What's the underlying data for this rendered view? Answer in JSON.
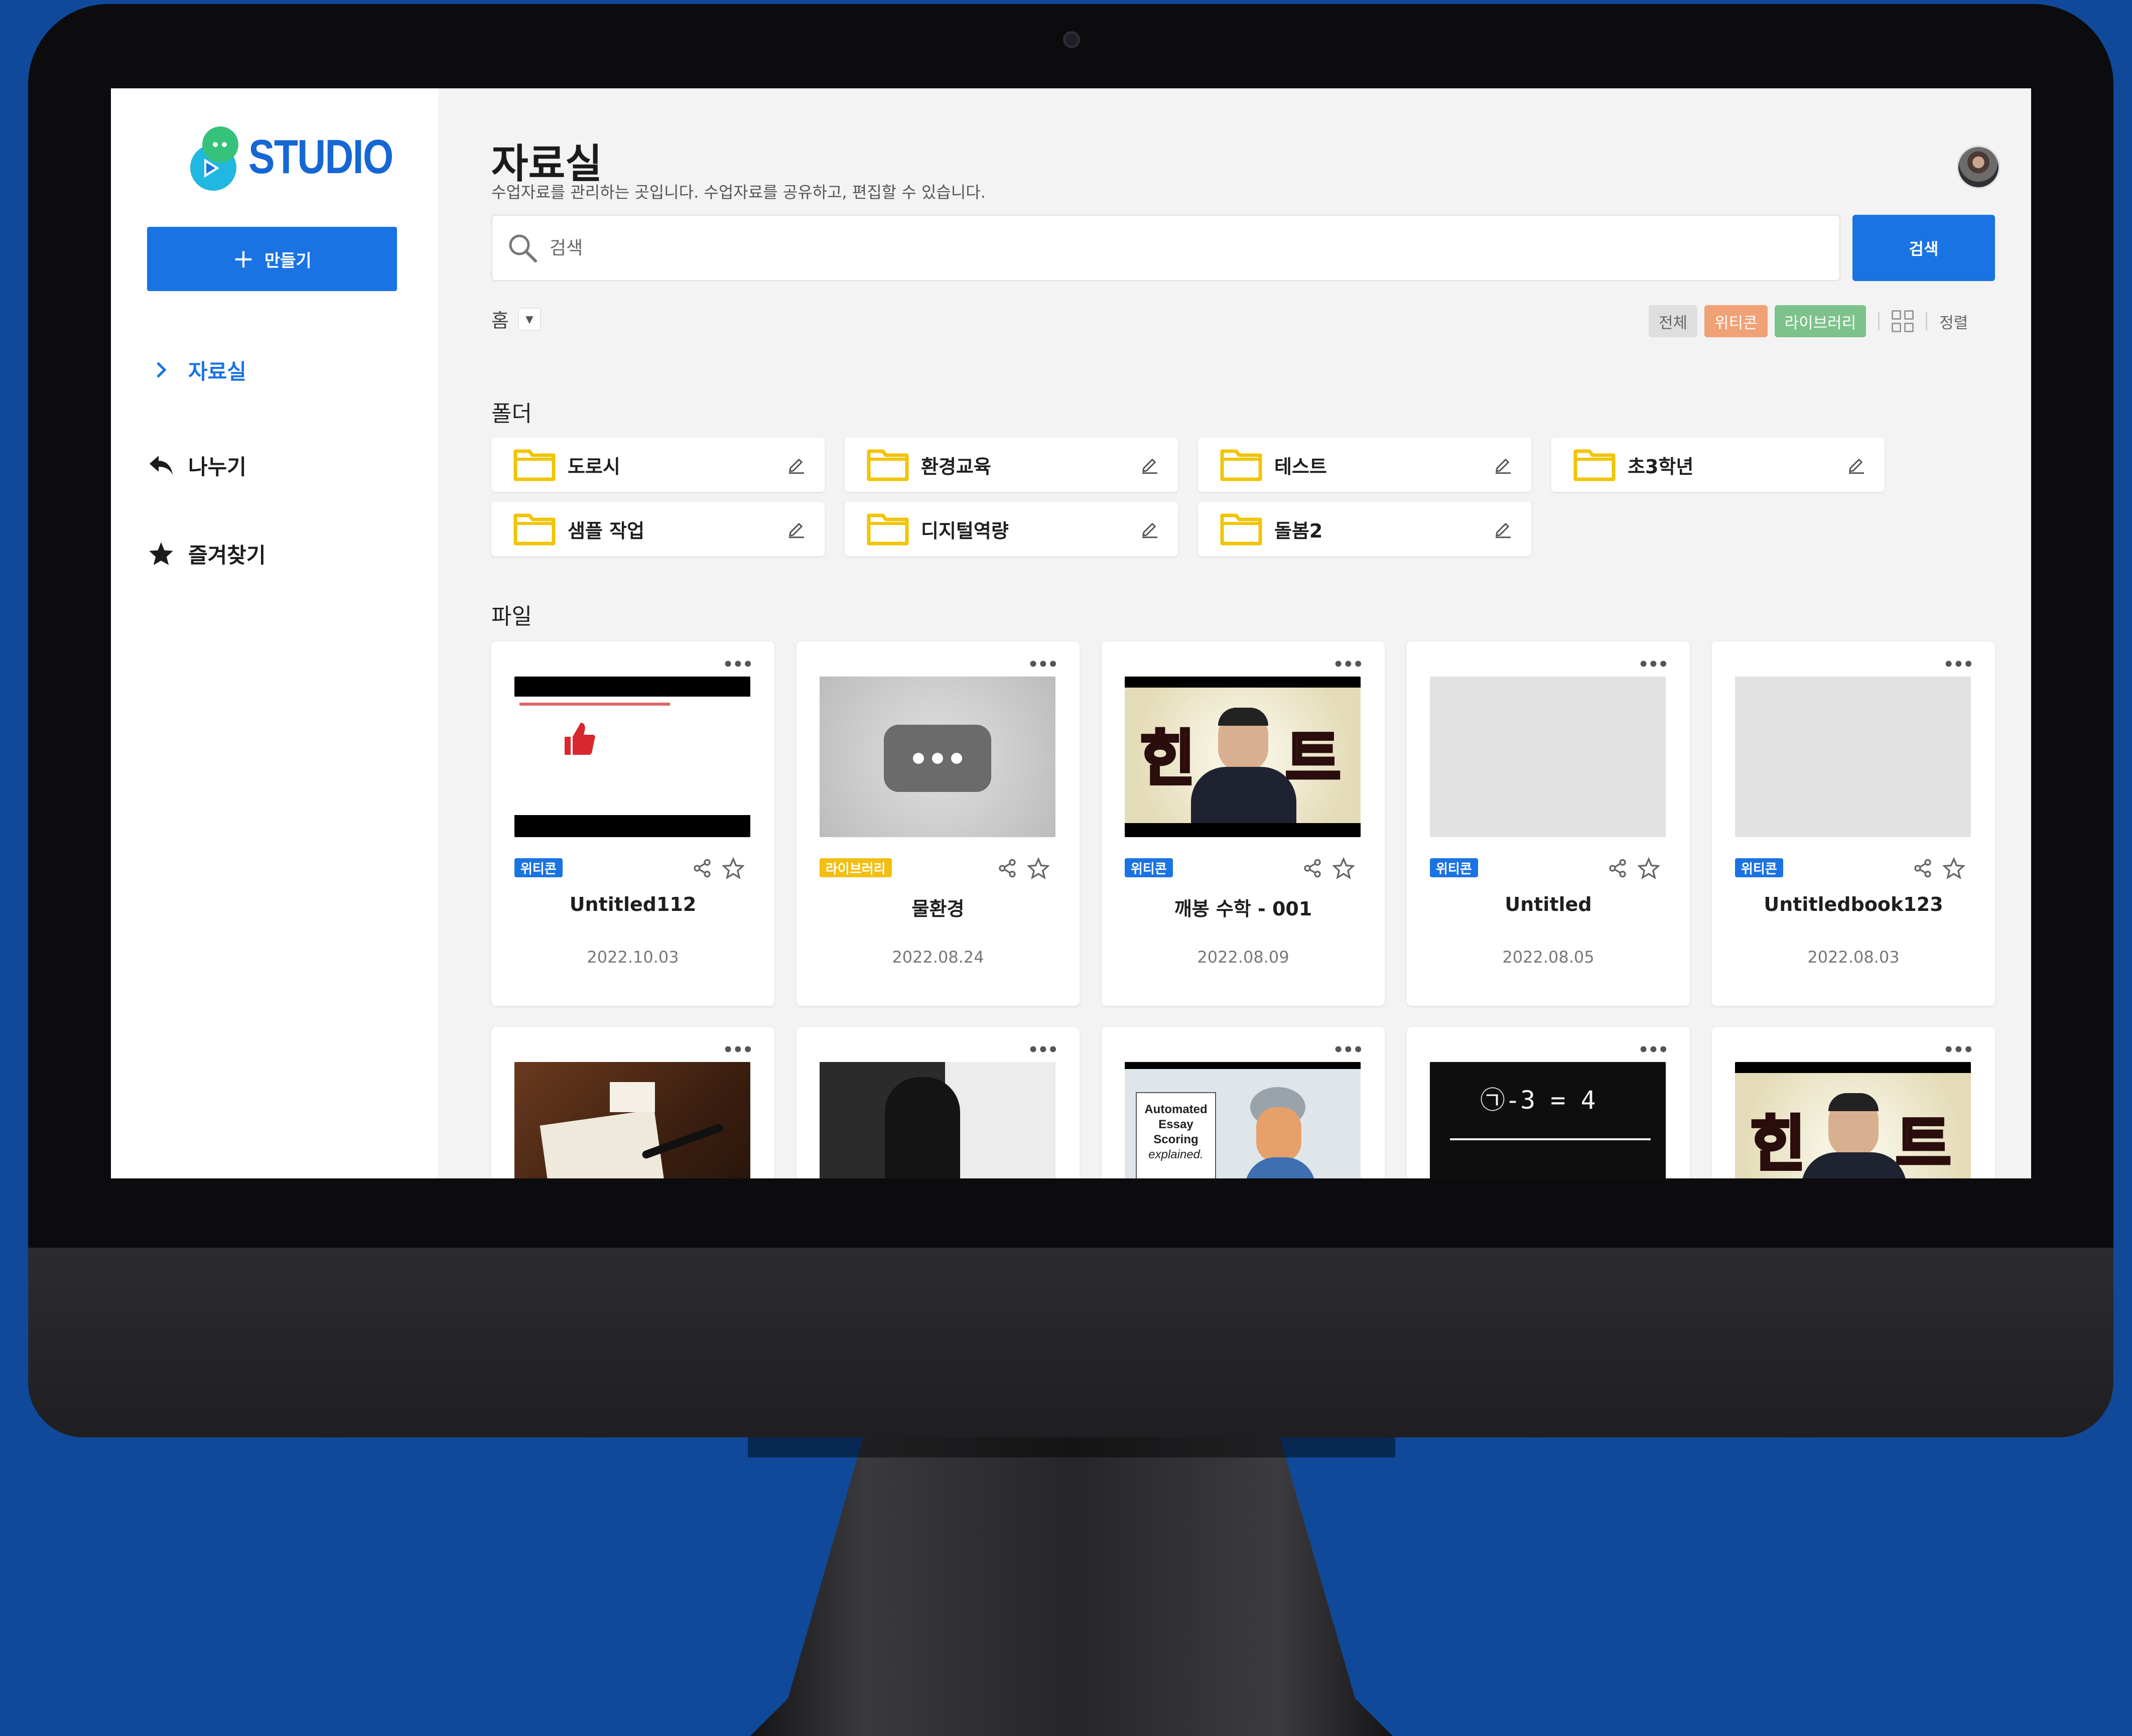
{
  "app": {
    "logo_text": "STUDIO",
    "create_label": "만들기",
    "nav": [
      {
        "label": "자료실",
        "icon": "chevron-right-icon",
        "active": true
      },
      {
        "label": "나누기",
        "icon": "reply-icon",
        "active": false
      },
      {
        "label": "즐겨찾기",
        "icon": "star-icon",
        "active": false
      }
    ]
  },
  "header": {
    "title": "자료실",
    "description": "수업자료를 관리하는 곳입니다. 수업자료를 공유하고, 편집할 수 있습니다."
  },
  "search": {
    "placeholder": "검색",
    "button_label": "검색"
  },
  "breadcrumb": {
    "home": "홈"
  },
  "filters": {
    "all": "전체",
    "witicon": "위티콘",
    "library": "라이브러리",
    "sort": "정렬",
    "colors": {
      "witicon": "#f0a176",
      "library": "#7dc28a"
    }
  },
  "folders": {
    "section_title": "폴더",
    "items": [
      "도로시",
      "환경교육",
      "테스트",
      "초3학년",
      "샘플 작업",
      "디지털역량",
      "돌봄2"
    ]
  },
  "files": {
    "section_title": "파일",
    "items": [
      {
        "badge": "위티콘",
        "title": "Untitled112",
        "date": "2022.10.03"
      },
      {
        "badge": "라이브러리",
        "title": "물환경",
        "date": "2022.08.24"
      },
      {
        "badge": "위티콘",
        "title": "깨봉 수학 - 001",
        "date": "2022.08.09"
      },
      {
        "badge": "위티콘",
        "title": "Untitled",
        "date": "2022.08.05"
      },
      {
        "badge": "위티콘",
        "title": "Untitledbook123",
        "date": "2022.08.03"
      }
    ],
    "thumb_texts": {
      "hint_left": "힌",
      "hint_right": "트",
      "essay": [
        "Automated",
        "Essay",
        "Scoring",
        "explained."
      ],
      "math": "㉠-3 = 4"
    }
  },
  "colors": {
    "accent": "#1a73e3",
    "background": "#10499a",
    "badge_library": "#f2bf11"
  }
}
